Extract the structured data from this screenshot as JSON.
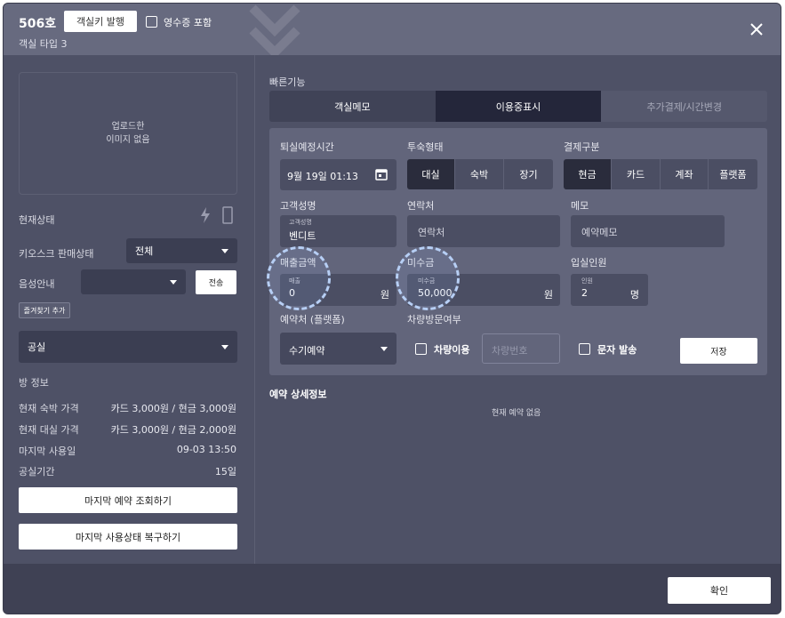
{
  "header": {
    "room_number": "506호",
    "issue_key_button": "객실키 발행",
    "receipt_checkbox_label": "영수증 포함",
    "room_type": "객실 타입 3"
  },
  "left": {
    "image_placeholder_line1": "업로드한",
    "image_placeholder_line2": "이미지 없음",
    "current_status_label": "현재상태",
    "kiosk_sale_label": "키오스크 판매상태",
    "kiosk_sale_value": "전체",
    "voice_guide_label": "음성안내",
    "voice_guide_value": "",
    "send_button": "전송",
    "add_favorite_button": "즐겨찾기 추가",
    "room_status_value": "공실",
    "room_info_title": "방 정보",
    "info_rows": [
      {
        "label": "현재 숙박 가격",
        "value": "카드 3,000원 / 현금 3,000원"
      },
      {
        "label": "현재 대실 가격",
        "value": "카드 3,000원 / 현금 2,000원"
      },
      {
        "label": "마지막 사용일",
        "value": "09-03 13:50"
      },
      {
        "label": "공실기간",
        "value": "15일"
      }
    ],
    "last_reservation_button": "마지막 예약 조회하기",
    "restore_status_button": "마지막 사용상태 복구하기"
  },
  "right": {
    "quick_title": "빠른기능",
    "tabs": [
      {
        "label": "객실메모"
      },
      {
        "label": "이용중표시"
      },
      {
        "label": "추가결제/시간변경"
      }
    ],
    "checkout_label": "퇴실예정시간",
    "checkout_value": "9월 19일 01:13",
    "stay_type_label": "투숙형태",
    "stay_types": [
      "대실",
      "숙박",
      "장기"
    ],
    "payment_label": "결제구분",
    "payment_types": [
      "현금",
      "카드",
      "계좌",
      "플랫폼"
    ],
    "guest_name_label": "고객성명",
    "guest_name_tiny": "고객성명",
    "guest_name_value": "벤디트",
    "contact_label": "연락처",
    "contact_placeholder": "연락처",
    "memo_label": "메모",
    "memo_placeholder": "예약메모",
    "sales_label": "매출금액",
    "sales_tiny": "매출",
    "sales_value": "0",
    "sales_unit": "원",
    "unpaid_label": "미수금",
    "unpaid_tiny": "미수금",
    "unpaid_value": "50,000",
    "unpaid_unit": "원",
    "guests_label": "입실인원",
    "guests_tiny": "인원",
    "guests_value": "2",
    "guests_unit": "명",
    "booking_source_label": "예약처 (플랫폼)",
    "booking_source_value": "수기예약",
    "vehicle_label": "차량방문여부",
    "vehicle_checkbox": "차량이용",
    "vehicle_number_placeholder": "차량번호",
    "sms_checkbox": "문자 발송",
    "save_button": "저장",
    "reservation_detail_title": "예약 상세정보",
    "no_reservation_text": "현재 예약 없음"
  },
  "footer": {
    "confirm_button": "확인"
  }
}
